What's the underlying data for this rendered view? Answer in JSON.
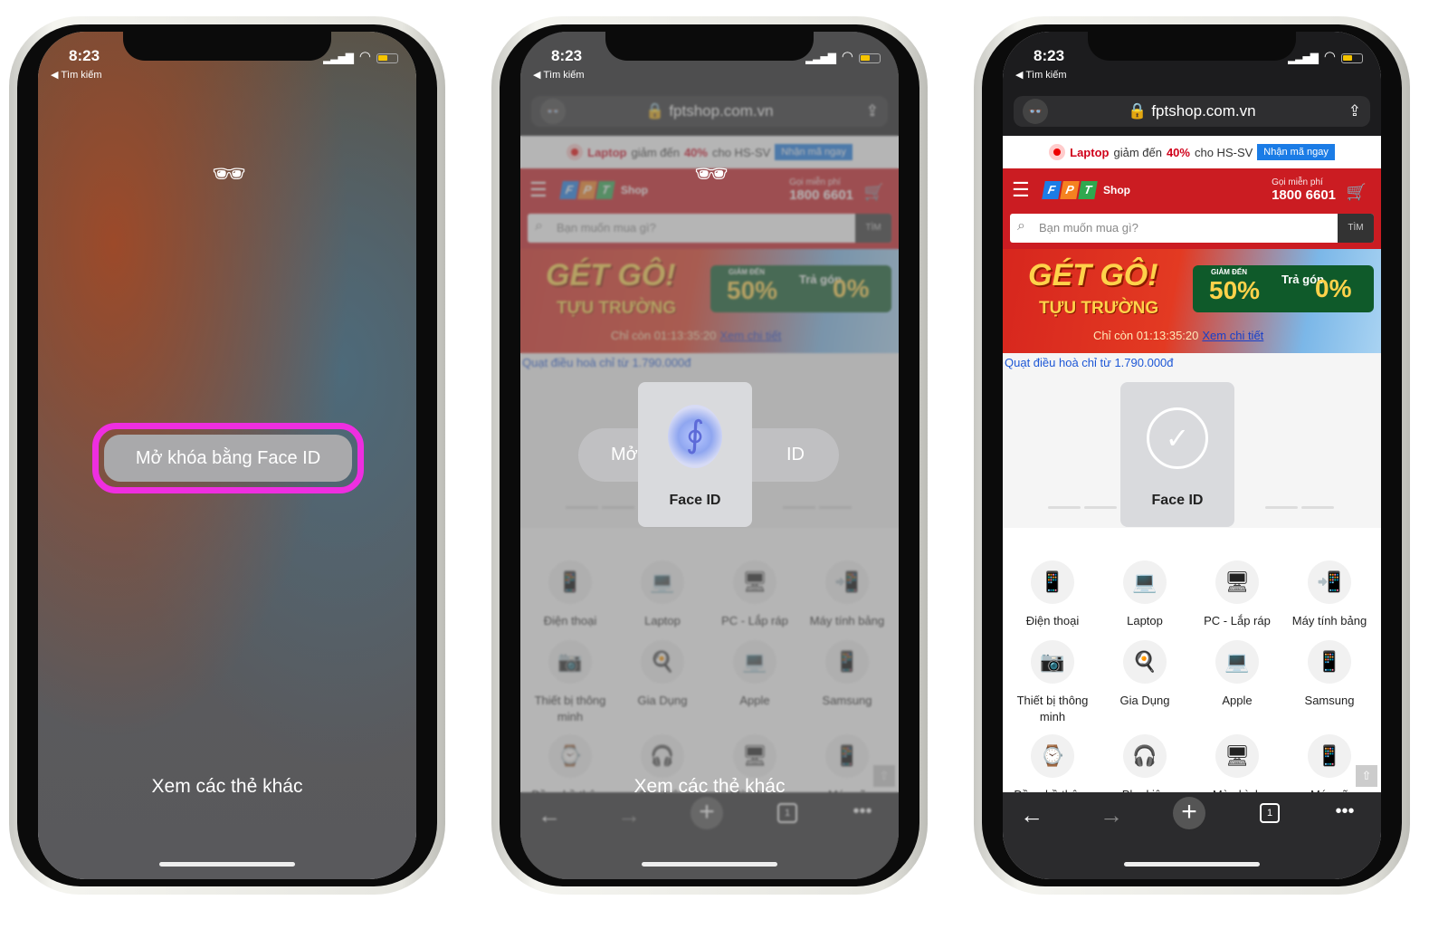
{
  "status": {
    "time": "8:23",
    "back": "◀ Tìm kiếm"
  },
  "lock": {
    "unlock_button": "Mở khóa bằng Face ID",
    "more_tabs": "Xem các thẻ khác",
    "pill_left": "Mở",
    "pill_right": "ID"
  },
  "browser": {
    "url": "fptshop.com.vn",
    "incognito_icon": "incognito-icon",
    "share_icon": "share-icon"
  },
  "promo": {
    "product": "Laptop",
    "text1": "giảm đến",
    "discount": "40%",
    "text2": "cho HS-SV",
    "button": "Nhận mã ngay"
  },
  "header": {
    "brand_letters": [
      "F",
      "P",
      "T"
    ],
    "brand_colors": [
      "#1b7ce6",
      "#f58220",
      "#2fa84f"
    ],
    "brand_shop": "Shop",
    "hotline_label": "Gọi miễn phí",
    "hotline": "1800 6601",
    "search_placeholder": "Bạn muốn mua gì?",
    "search_button": "TÌM"
  },
  "banner": {
    "title": "GÉT GÔ!",
    "subtitle": "TỰU TRƯỜNG",
    "sale_label": "GIẢM ĐẾN",
    "sale": "50%",
    "installment": "Trả góp",
    "installment_rate": "0%",
    "countdown": "Chỉ còn 01:13:35:20",
    "details_link": "Xem chi tiết"
  },
  "deal": "Quạt điều hoà chỉ từ 1.790.000đ",
  "faceid": {
    "label": "Face ID"
  },
  "categories": [
    {
      "label": "Điện thoại",
      "icon": "📱"
    },
    {
      "label": "Laptop",
      "icon": "💻"
    },
    {
      "label": "PC - Lắp ráp",
      "icon": "🖥"
    },
    {
      "label": "Máy tính bảng",
      "icon": "📲"
    },
    {
      "label": "Thiết bị thông minh",
      "icon": "📷"
    },
    {
      "label": "Gia Dụng",
      "icon": "🍳"
    },
    {
      "label": "Apple",
      "icon": "💻"
    },
    {
      "label": "Samsung",
      "icon": "📱"
    },
    {
      "label": "Đồng hồ thông minh",
      "icon": "⌚"
    },
    {
      "label": "Phụ kiện",
      "icon": "🎧"
    },
    {
      "label": "Màn hình",
      "icon": "🖥"
    },
    {
      "label": "Máy cũ",
      "icon": "📱"
    }
  ],
  "toolbar": {
    "tab_count": "1"
  },
  "colors": {
    "fpt_red": "#cb1c22",
    "highlight": "#ee2ee0",
    "link": "#1d57d6"
  }
}
